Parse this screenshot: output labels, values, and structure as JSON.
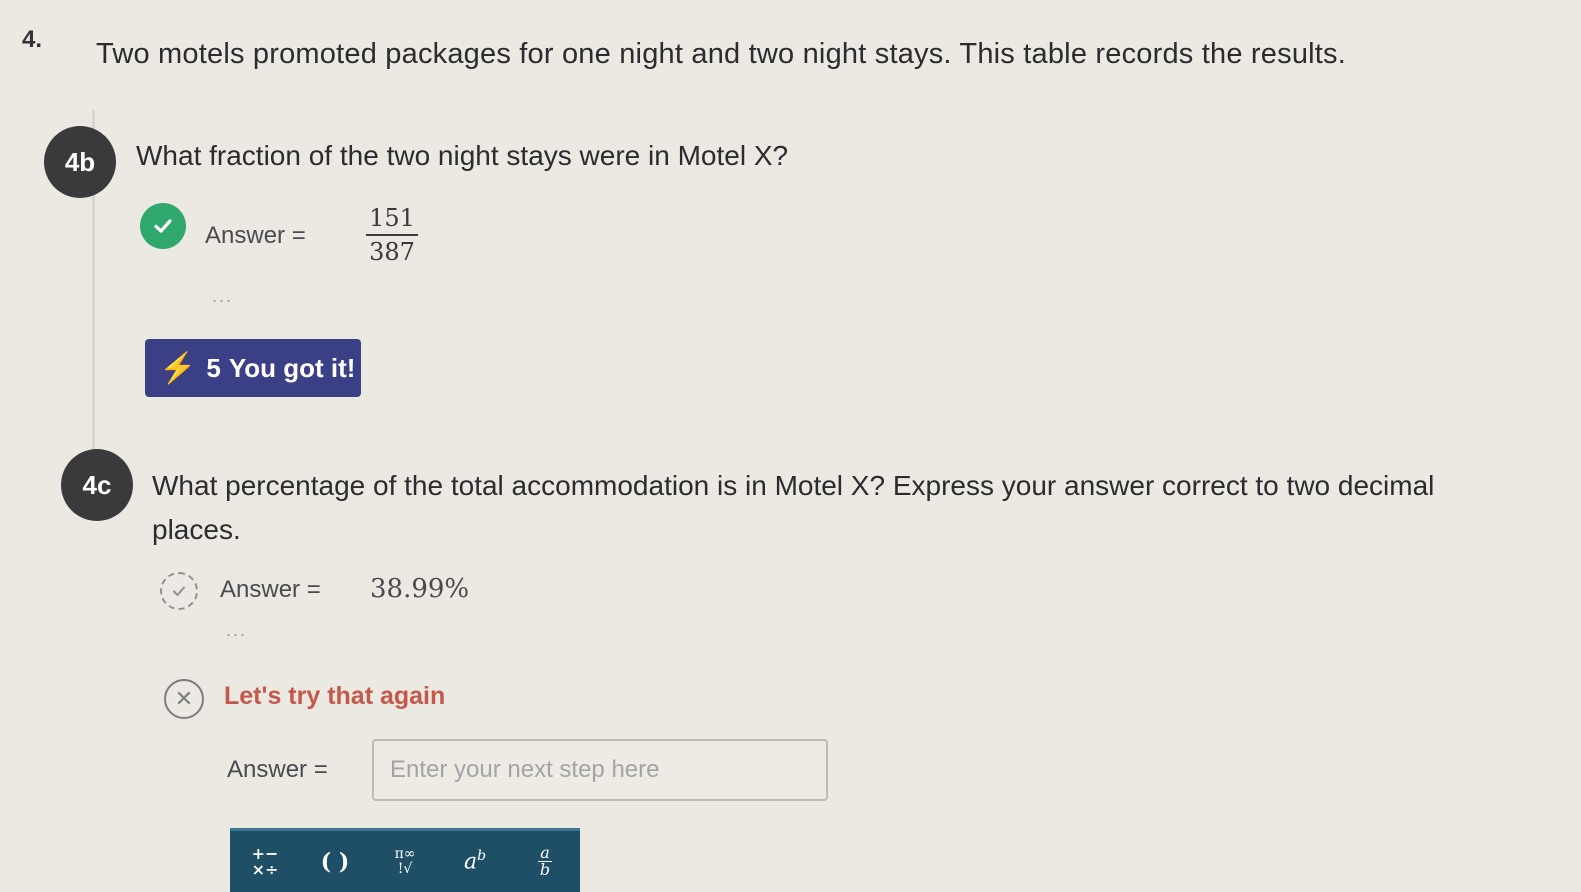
{
  "question": {
    "number": "4.",
    "text": "Two motels promoted packages for one night and two night stays. This table records the results."
  },
  "part_4b": {
    "badge": "4b",
    "question": "What fraction of the two night stays were in Motel X?",
    "answer_label": "Answer =",
    "answer_numerator": "151",
    "answer_denominator": "387",
    "status": "correct",
    "dots": "...",
    "feedback": {
      "points": "5",
      "message": "You got it!"
    }
  },
  "part_4c": {
    "badge": "4c",
    "question": "What percentage of the total accommodation is in Motel X? Express your answer correct to two decimal places.",
    "answer_label": "Answer =",
    "answer_value": "38.99%",
    "status": "incorrect",
    "dots": "...",
    "feedback": "Let's try that again",
    "next_answer_label": "Answer =",
    "input_placeholder": "Enter your next step here"
  },
  "toolbar": {
    "buttons": [
      {
        "icon": "arithmetic-operators-icon",
        "glyph": "+−\n×÷"
      },
      {
        "icon": "parentheses-icon",
        "glyph": "( )"
      },
      {
        "icon": "pi-infinity-sqrt-icon",
        "glyph": "π∞\n!√"
      },
      {
        "icon": "exponent-icon",
        "glyph": "aᵇ"
      },
      {
        "icon": "fraction-icon",
        "glyph": "a/b"
      }
    ]
  },
  "colors": {
    "correct_green": "#2fa86e",
    "feedback_purple": "#3b3f86",
    "retry_red": "#c4584a",
    "toolbar_teal": "#1f4f67"
  }
}
